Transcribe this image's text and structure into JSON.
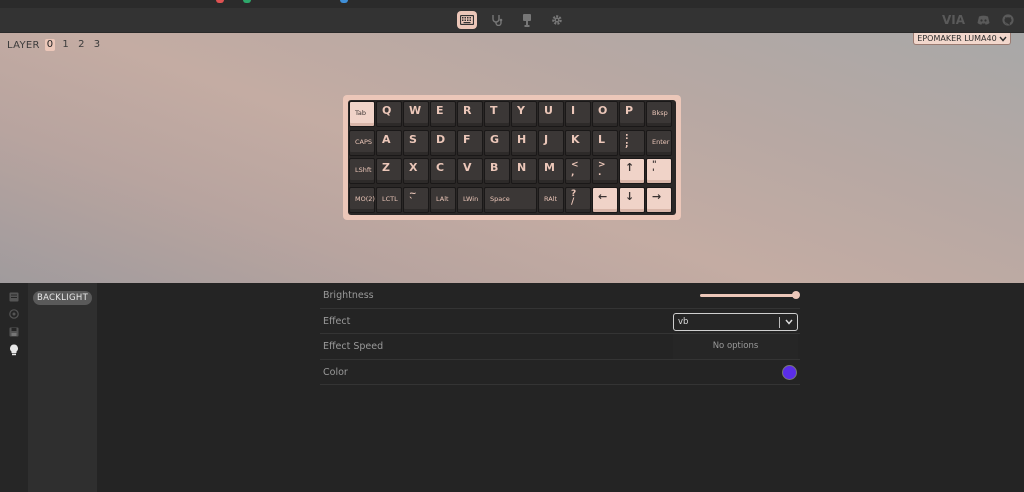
{
  "header": {
    "tabs": [
      {
        "id": "configure",
        "icon": "keyboard-icon",
        "active": true
      },
      {
        "id": "test",
        "icon": "stethoscope-icon",
        "active": false
      },
      {
        "id": "design",
        "icon": "usb-icon",
        "active": false
      },
      {
        "id": "settings",
        "icon": "gear-icon",
        "active": false
      }
    ],
    "brand": "VIA",
    "right_icons": [
      "discord-icon",
      "github-icon"
    ]
  },
  "layer": {
    "label": "LAYER",
    "layers": [
      "0",
      "1",
      "2",
      "3"
    ],
    "active": "0"
  },
  "device": {
    "name": "EPOMAKER LUMA40",
    "chevron": "chevron-down-icon"
  },
  "keyboard": {
    "rows": [
      [
        {
          "l": "Tab",
          "s": 1,
          "light": 1
        },
        {
          "l": "Q"
        },
        {
          "l": "W"
        },
        {
          "l": "E"
        },
        {
          "l": "R"
        },
        {
          "l": "T"
        },
        {
          "l": "Y"
        },
        {
          "l": "U"
        },
        {
          "l": "I"
        },
        {
          "l": "O"
        },
        {
          "l": "P"
        },
        {
          "l": "Bksp",
          "s": 1
        }
      ],
      [
        {
          "l": "CAPS",
          "s": 1
        },
        {
          "l": "A"
        },
        {
          "l": "S"
        },
        {
          "l": "D"
        },
        {
          "l": "F"
        },
        {
          "l": "G"
        },
        {
          "l": "H"
        },
        {
          "l": "J"
        },
        {
          "l": "K"
        },
        {
          "l": "L"
        },
        {
          "l": ":",
          "l2": ";"
        },
        {
          "l": "Enter",
          "s": 1
        }
      ],
      [
        {
          "l": "LShft",
          "s": 1
        },
        {
          "l": "Z"
        },
        {
          "l": "X"
        },
        {
          "l": "C"
        },
        {
          "l": "V"
        },
        {
          "l": "B"
        },
        {
          "l": "N"
        },
        {
          "l": "M"
        },
        {
          "l": "<",
          "l2": ","
        },
        {
          "l": ">",
          "l2": "."
        },
        {
          "l": "↑",
          "light": 1
        },
        {
          "l": "\"",
          "l2": "'",
          "light": 1
        }
      ],
      [
        {
          "l": "MO(2)",
          "s": 1
        },
        {
          "l": "LCTL",
          "s": 1
        },
        {
          "l": "~",
          "l2": "`"
        },
        {
          "l": "LAlt",
          "s": 1
        },
        {
          "l": "LWin",
          "s": 1
        },
        {
          "l": "Space",
          "s": 1,
          "w": 2
        },
        {
          "l": "RAlt",
          "s": 1
        },
        {
          "l": "?",
          "l2": "/"
        },
        {
          "l": "←",
          "light": 1
        },
        {
          "l": "↓",
          "light": 1
        },
        {
          "l": "→",
          "light": 1
        }
      ]
    ]
  },
  "sidebar": {
    "icons": [
      "keymap-icon",
      "macro-icon",
      "save-icon",
      "lightbulb-icon"
    ],
    "active_icon": "lightbulb-icon",
    "section": "BACKLIGHT"
  },
  "settings": {
    "brightness": {
      "label": "Brightness",
      "value_fraction": 1.0
    },
    "effect": {
      "label": "Effect",
      "input_value": "vb",
      "dropdown_text": "No options"
    },
    "effect_speed": {
      "label": "Effect Speed"
    },
    "color": {
      "label": "Color",
      "value": "#5b2de8"
    }
  },
  "colors": {
    "accent": "#ecc7b9",
    "topstrip_dots": [
      "#e05252",
      "#2ea86b",
      "#3f8fd8"
    ]
  }
}
